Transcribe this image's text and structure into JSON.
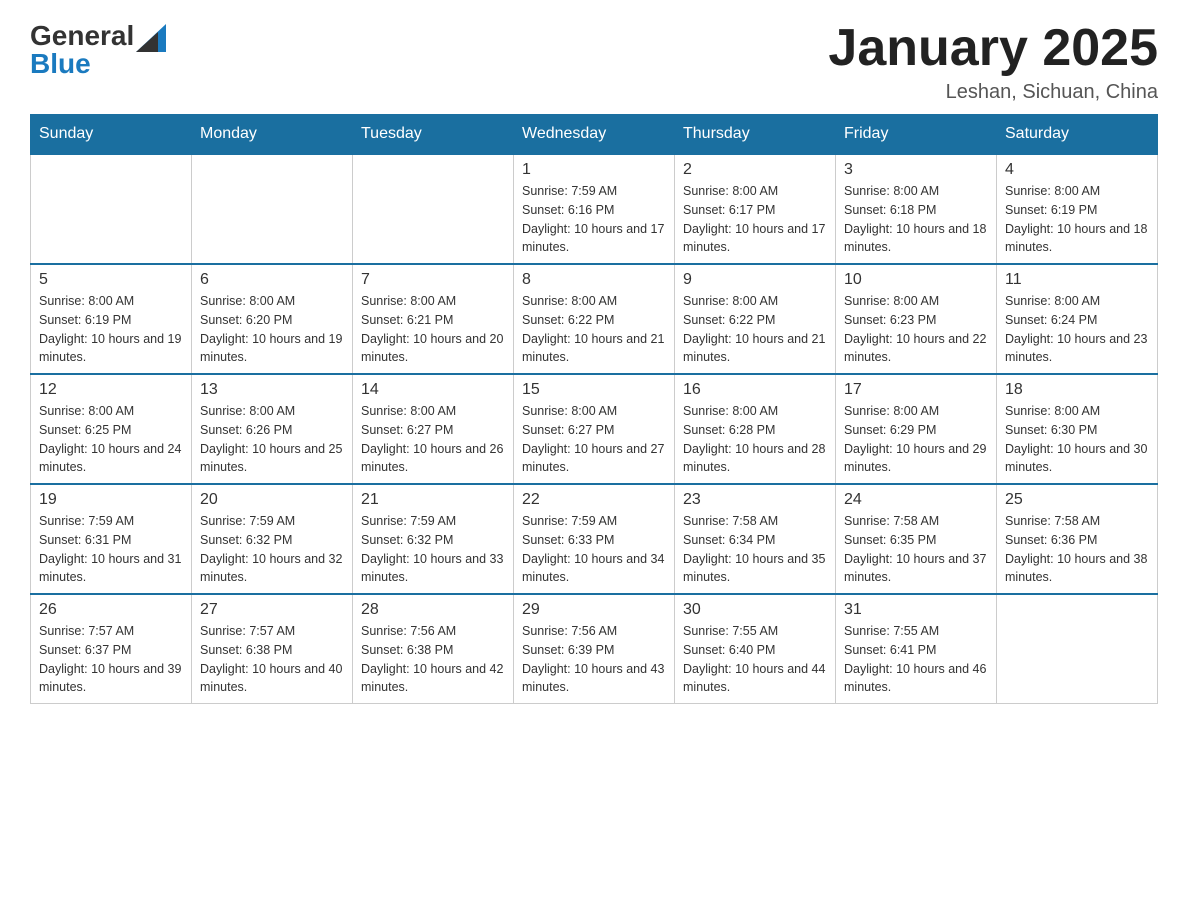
{
  "header": {
    "logo_text_general": "General",
    "logo_text_blue": "Blue",
    "month_title": "January 2025",
    "location": "Leshan, Sichuan, China"
  },
  "days_of_week": [
    "Sunday",
    "Monday",
    "Tuesday",
    "Wednesday",
    "Thursday",
    "Friday",
    "Saturday"
  ],
  "weeks": [
    {
      "cells": [
        {
          "day": "",
          "info": ""
        },
        {
          "day": "",
          "info": ""
        },
        {
          "day": "",
          "info": ""
        },
        {
          "day": "1",
          "sunrise": "7:59 AM",
          "sunset": "6:16 PM",
          "daylight": "10 hours and 17 minutes."
        },
        {
          "day": "2",
          "sunrise": "8:00 AM",
          "sunset": "6:17 PM",
          "daylight": "10 hours and 17 minutes."
        },
        {
          "day": "3",
          "sunrise": "8:00 AM",
          "sunset": "6:18 PM",
          "daylight": "10 hours and 18 minutes."
        },
        {
          "day": "4",
          "sunrise": "8:00 AM",
          "sunset": "6:19 PM",
          "daylight": "10 hours and 18 minutes."
        }
      ]
    },
    {
      "cells": [
        {
          "day": "5",
          "sunrise": "8:00 AM",
          "sunset": "6:19 PM",
          "daylight": "10 hours and 19 minutes."
        },
        {
          "day": "6",
          "sunrise": "8:00 AM",
          "sunset": "6:20 PM",
          "daylight": "10 hours and 19 minutes."
        },
        {
          "day": "7",
          "sunrise": "8:00 AM",
          "sunset": "6:21 PM",
          "daylight": "10 hours and 20 minutes."
        },
        {
          "day": "8",
          "sunrise": "8:00 AM",
          "sunset": "6:22 PM",
          "daylight": "10 hours and 21 minutes."
        },
        {
          "day": "9",
          "sunrise": "8:00 AM",
          "sunset": "6:22 PM",
          "daylight": "10 hours and 21 minutes."
        },
        {
          "day": "10",
          "sunrise": "8:00 AM",
          "sunset": "6:23 PM",
          "daylight": "10 hours and 22 minutes."
        },
        {
          "day": "11",
          "sunrise": "8:00 AM",
          "sunset": "6:24 PM",
          "daylight": "10 hours and 23 minutes."
        }
      ]
    },
    {
      "cells": [
        {
          "day": "12",
          "sunrise": "8:00 AM",
          "sunset": "6:25 PM",
          "daylight": "10 hours and 24 minutes."
        },
        {
          "day": "13",
          "sunrise": "8:00 AM",
          "sunset": "6:26 PM",
          "daylight": "10 hours and 25 minutes."
        },
        {
          "day": "14",
          "sunrise": "8:00 AM",
          "sunset": "6:27 PM",
          "daylight": "10 hours and 26 minutes."
        },
        {
          "day": "15",
          "sunrise": "8:00 AM",
          "sunset": "6:27 PM",
          "daylight": "10 hours and 27 minutes."
        },
        {
          "day": "16",
          "sunrise": "8:00 AM",
          "sunset": "6:28 PM",
          "daylight": "10 hours and 28 minutes."
        },
        {
          "day": "17",
          "sunrise": "8:00 AM",
          "sunset": "6:29 PM",
          "daylight": "10 hours and 29 minutes."
        },
        {
          "day": "18",
          "sunrise": "8:00 AM",
          "sunset": "6:30 PM",
          "daylight": "10 hours and 30 minutes."
        }
      ]
    },
    {
      "cells": [
        {
          "day": "19",
          "sunrise": "7:59 AM",
          "sunset": "6:31 PM",
          "daylight": "10 hours and 31 minutes."
        },
        {
          "day": "20",
          "sunrise": "7:59 AM",
          "sunset": "6:32 PM",
          "daylight": "10 hours and 32 minutes."
        },
        {
          "day": "21",
          "sunrise": "7:59 AM",
          "sunset": "6:32 PM",
          "daylight": "10 hours and 33 minutes."
        },
        {
          "day": "22",
          "sunrise": "7:59 AM",
          "sunset": "6:33 PM",
          "daylight": "10 hours and 34 minutes."
        },
        {
          "day": "23",
          "sunrise": "7:58 AM",
          "sunset": "6:34 PM",
          "daylight": "10 hours and 35 minutes."
        },
        {
          "day": "24",
          "sunrise": "7:58 AM",
          "sunset": "6:35 PM",
          "daylight": "10 hours and 37 minutes."
        },
        {
          "day": "25",
          "sunrise": "7:58 AM",
          "sunset": "6:36 PM",
          "daylight": "10 hours and 38 minutes."
        }
      ]
    },
    {
      "cells": [
        {
          "day": "26",
          "sunrise": "7:57 AM",
          "sunset": "6:37 PM",
          "daylight": "10 hours and 39 minutes."
        },
        {
          "day": "27",
          "sunrise": "7:57 AM",
          "sunset": "6:38 PM",
          "daylight": "10 hours and 40 minutes."
        },
        {
          "day": "28",
          "sunrise": "7:56 AM",
          "sunset": "6:38 PM",
          "daylight": "10 hours and 42 minutes."
        },
        {
          "day": "29",
          "sunrise": "7:56 AM",
          "sunset": "6:39 PM",
          "daylight": "10 hours and 43 minutes."
        },
        {
          "day": "30",
          "sunrise": "7:55 AM",
          "sunset": "6:40 PM",
          "daylight": "10 hours and 44 minutes."
        },
        {
          "day": "31",
          "sunrise": "7:55 AM",
          "sunset": "6:41 PM",
          "daylight": "10 hours and 46 minutes."
        },
        {
          "day": "",
          "info": ""
        }
      ]
    }
  ],
  "labels": {
    "sunrise_prefix": "Sunrise: ",
    "sunset_prefix": "Sunset: ",
    "daylight_prefix": "Daylight: "
  }
}
